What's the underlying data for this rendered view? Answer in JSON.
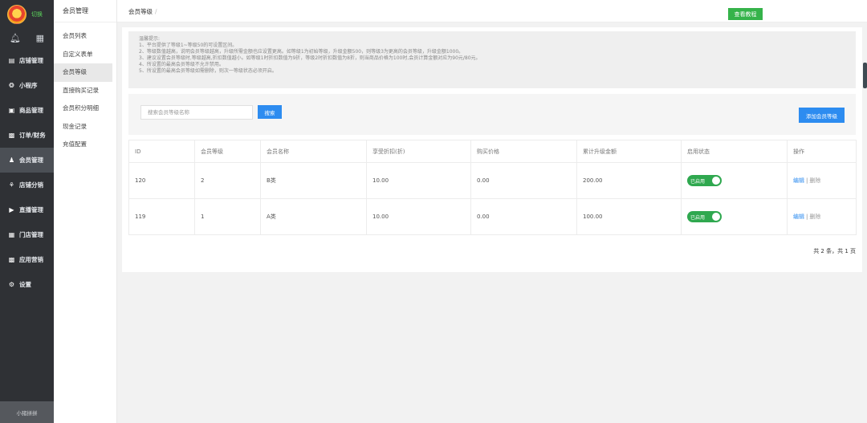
{
  "app": {
    "logo_text": "切换",
    "user_text": "小猪拼拼"
  },
  "sidebar": {
    "items": [
      {
        "label": "店铺管理",
        "icon": "store-icon"
      },
      {
        "label": "小程序",
        "icon": "miniapp-icon"
      },
      {
        "label": "商品管理",
        "icon": "product-icon"
      },
      {
        "label": "订单/财务",
        "icon": "order-icon"
      },
      {
        "label": "会员管理",
        "icon": "member-icon"
      },
      {
        "label": "店铺分销",
        "icon": "distribution-icon"
      },
      {
        "label": "直播管理",
        "icon": "live-icon"
      },
      {
        "label": "门店管理",
        "icon": "shop-icon"
      },
      {
        "label": "应用营销",
        "icon": "apps-icon"
      },
      {
        "label": "设置",
        "icon": "gear-icon"
      }
    ]
  },
  "subnav": {
    "title": "会员管理",
    "items": [
      "会员列表",
      "自定义表单",
      "会员等级",
      "直接购买记录",
      "会员积分明细",
      "现金记录",
      "充值配置"
    ]
  },
  "header": {
    "breadcrumb": "会员等级",
    "breadcrumb_sep": "/",
    "tutorial_label": "查看教程"
  },
  "tips": {
    "lines": [
      "温馨提示:",
      "1、平台提供了等级1~等级50的可设置区间。",
      "2、等级数值越高，说明会员等级越高，升级所需金额也应设置更高。如等级1为初始等级，升级金额500，则等级3为更高的会员等级，升级金额1000。",
      "3、建议设置会员等级时,等级越高,折扣数值越小。如等级1时折扣数值为9折，等级2时折扣数值为8折，则当商品价格为100时,会员计算金额对应为90元/80元。",
      "4、所设置的最高会员等级不允许禁用。",
      "5、所设置的最高会员等级如需删除，则次一等级状态必须开启。"
    ]
  },
  "search": {
    "placeholder": "搜索会员等级名称",
    "button_label": "搜索",
    "add_label": "添加会员等级"
  },
  "table": {
    "headers": [
      "ID",
      "会员等级",
      "会员名称",
      "享受折扣(折)",
      "购买价格",
      "累计升级金额",
      "启用状态",
      "操作"
    ],
    "rows": [
      {
        "id": "120",
        "level": "2",
        "name": "B类",
        "discount": "10.00",
        "price": "0.00",
        "amount": "200.00",
        "status": "已启用",
        "enabled": true,
        "edit": "编辑",
        "sep": "|",
        "delete": "删除"
      },
      {
        "id": "119",
        "level": "1",
        "name": "A类",
        "discount": "10.00",
        "price": "0.00",
        "amount": "100.00",
        "status": "已启用",
        "enabled": true,
        "edit": "编辑",
        "sep": "|",
        "delete": "删除"
      }
    ]
  },
  "pager": {
    "text": "共 2 条，共 1 页"
  },
  "colors": {
    "primary": "#2d8cf0",
    "success": "#2fa84f",
    "sidebar": "#2f3135"
  }
}
